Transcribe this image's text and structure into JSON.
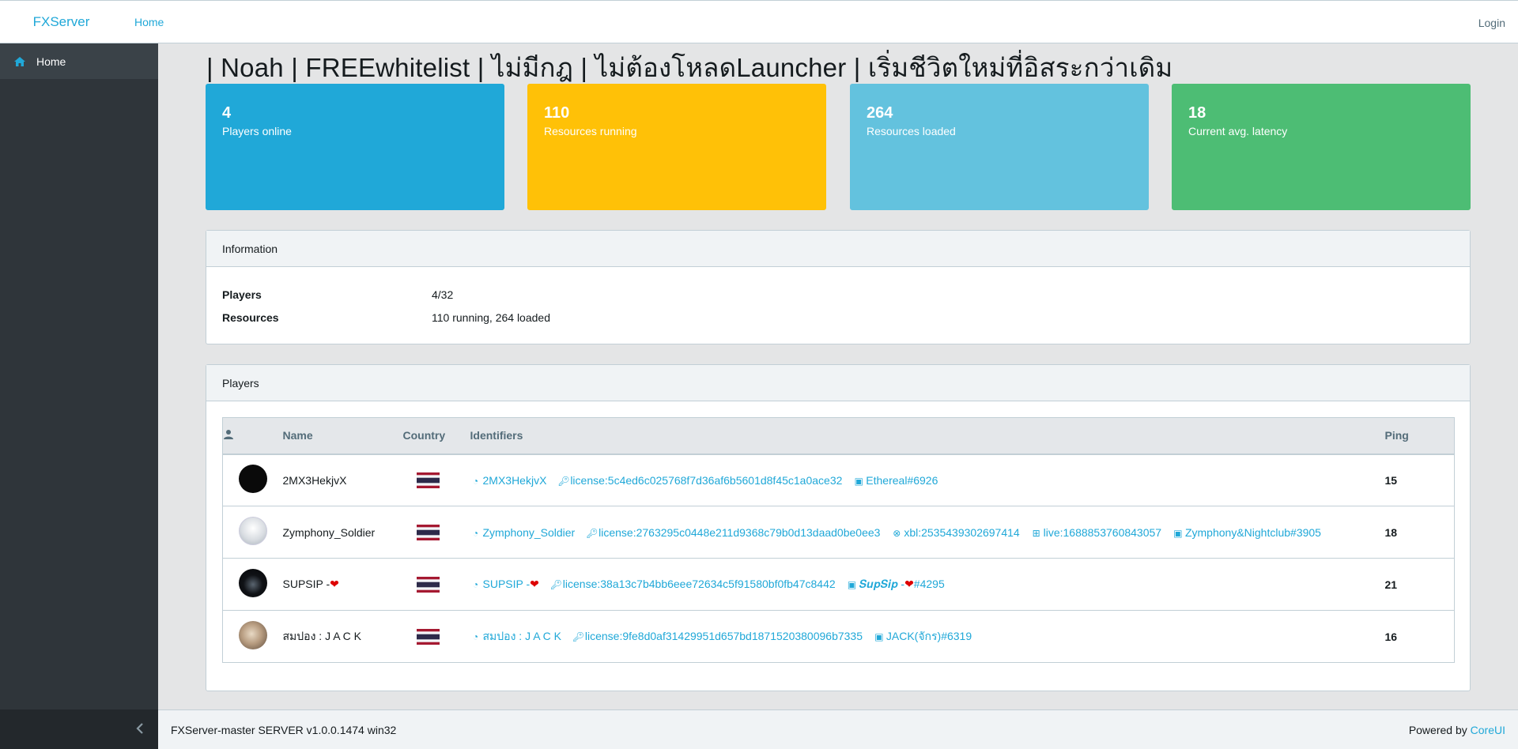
{
  "header": {
    "brand": "FXServer",
    "nav_home": "Home",
    "login": "Login"
  },
  "sidebar": {
    "items": [
      {
        "label": "Home",
        "icon": "home-icon"
      }
    ],
    "minimize_icon": "chevron-left-icon"
  },
  "page_title": "| Noah | FREEwhitelist | ไม่มีกฎ | ไม่ต้องโหลดLauncher | เริ่มชีวิตใหม่ที่อิสระกว่าเดิม",
  "stats": [
    {
      "value": "4",
      "label": "Players online",
      "color": "#20a8d8"
    },
    {
      "value": "110",
      "label": "Resources running",
      "color": "#ffc107"
    },
    {
      "value": "264",
      "label": "Resources loaded",
      "color": "#63c2de"
    },
    {
      "value": "18",
      "label": "Current avg. latency",
      "color": "#4dbd74"
    }
  ],
  "information": {
    "title": "Information",
    "rows": [
      {
        "key": "Players",
        "value": "4/32"
      },
      {
        "key": "Resources",
        "value": "110 running, 264 loaded"
      }
    ]
  },
  "players": {
    "title": "Players",
    "columns": {
      "name": "Name",
      "country": "Country",
      "identifiers": "Identifiers",
      "ping": "Ping"
    },
    "rows": [
      {
        "name": "2MX3HekjvX",
        "ping": "15",
        "identifiers": [
          {
            "type": "steam",
            "text": "2MX3HekjvX"
          },
          {
            "type": "license",
            "text": "license:5c4ed6c025768f7d36af6b5601d8f45c1a0ace32"
          },
          {
            "type": "discord",
            "text": "Ethereal#6926"
          }
        ]
      },
      {
        "name": "Zymphony_Soldier",
        "ping": "18",
        "identifiers": [
          {
            "type": "steam",
            "text": "Zymphony_Soldier"
          },
          {
            "type": "license",
            "text": "license:2763295c0448e211d9368c79b0d13daad0be0ee3"
          },
          {
            "type": "xbox",
            "text": "xbl:2535439302697414"
          },
          {
            "type": "windows",
            "text": "live:1688853760843057"
          },
          {
            "type": "discord",
            "text": "Zymphony&Nightclub#3905"
          }
        ]
      },
      {
        "name": "SUPSIP -",
        "ping": "21",
        "identifiers": [
          {
            "type": "steam",
            "text": "SUPSIP -"
          },
          {
            "type": "license",
            "text": "license:38a13c7b4bb6eee72634c5f91580bf0fb47c8442"
          },
          {
            "type": "discord",
            "text": "𝑺𝒖𝒑𝑺𝒊𝒑 -",
            "suffix": "#4295"
          }
        ]
      },
      {
        "name": "สมปอง : J A C K",
        "ping": "16",
        "identifiers": [
          {
            "type": "steam",
            "text": "สมปอง : J A C K"
          },
          {
            "type": "license",
            "text": "license:9fe8d0af31429951d657bd1871520380096b7335"
          },
          {
            "type": "discord",
            "text": "JACK(จักร)#6319"
          }
        ]
      }
    ]
  },
  "footer": {
    "version": "FXServer-master SERVER v1.0.0.1474 win32",
    "powered_by": "Powered by",
    "powered_link": "CoreUI"
  }
}
